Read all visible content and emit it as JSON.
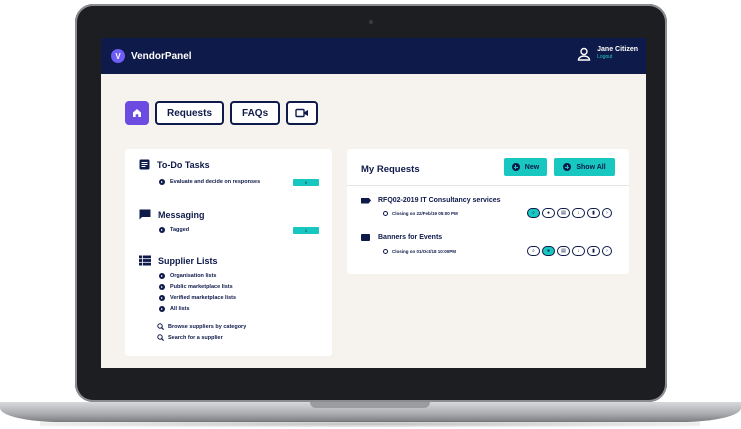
{
  "header": {
    "app_title": "VendorPanel",
    "user_name": "Jane Citizen",
    "logout_label": "Logout"
  },
  "nav": {
    "requests_label": "Requests",
    "faqs_label": "FAQs"
  },
  "todo": {
    "title": "To-Do Tasks",
    "items": [
      {
        "label": "Evaluate and decide on responses",
        "count": "0"
      }
    ]
  },
  "messaging": {
    "title": "Messaging",
    "items": [
      {
        "label": "Tagged",
        "count": "1"
      }
    ]
  },
  "supplier_lists": {
    "title": "Supplier Lists",
    "items": [
      {
        "label": "Organisation lists"
      },
      {
        "label": "Public marketplace lists"
      },
      {
        "label": "Verified marketplace lists"
      },
      {
        "label": "All lists"
      }
    ],
    "searches": [
      {
        "label": "Browse suppliers by category"
      },
      {
        "label": "Search for a supplier"
      }
    ]
  },
  "my_requests": {
    "title": "My Requests",
    "new_label": "New",
    "show_all_label": "Show All",
    "requests": [
      {
        "title": "RFQ02-2019 IT Consultancy services",
        "closing": "Closing on 22/Feb/19 05:00 PM"
      },
      {
        "title": "Banners for Events",
        "closing": "Closing on 01/Oct/18 10:00PM"
      }
    ]
  },
  "colors": {
    "navy": "#0e1a4a",
    "teal": "#18c7c0",
    "purple": "#6c4ce0",
    "background": "#f6f2ee"
  }
}
